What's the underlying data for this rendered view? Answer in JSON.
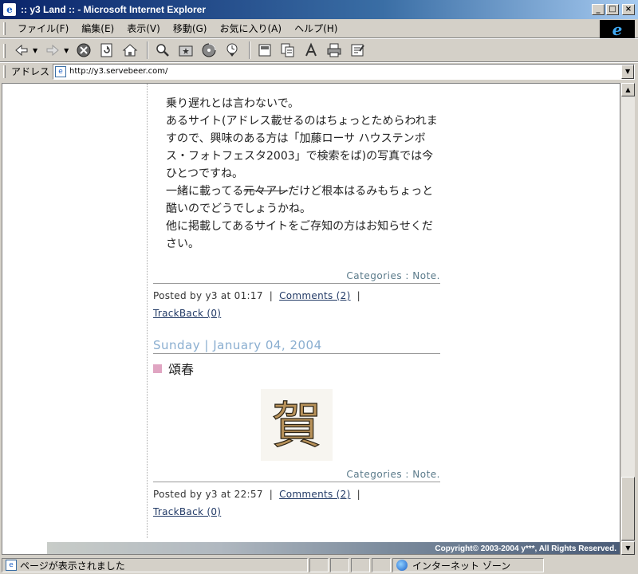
{
  "window": {
    "title": ":: y3 Land :: - Microsoft Internet Explorer",
    "minimize": "_",
    "maximize": "□",
    "close": "×"
  },
  "menu": {
    "items": [
      "ファイル(F)",
      "編集(E)",
      "表示(V)",
      "移動(G)",
      "お気に入り(A)",
      "ヘルプ(H)"
    ]
  },
  "address": {
    "label": "アドレス",
    "url": "http://y3.servebeer.com/"
  },
  "content": {
    "entry1": {
      "lines": [
        "乗り遅れとは言わないで。",
        "あるサイト(アドレス載せるのはちょっとためらわれますので、興味のある方は「加藤ローサ ハウステンボス・フォトフェスタ2003」で検索をば)の写真では今ひとつですね。"
      ],
      "line3_pre": "一緒に載ってる",
      "line3_strike": "元々アレ",
      "line3_post": "だけど根本はるみもちょっと酷いのでどうでしょうかね。",
      "line4": "他に掲載してあるサイトをご存知の方はお知らせください。",
      "categories": "Categories : Note.",
      "posted_by": "Posted by y3 at 01:17",
      "comments": "Comments (2)",
      "trackback": "TrackBack (0)"
    },
    "entry2": {
      "date": "Sunday | January 04, 2004",
      "title": "頌春",
      "image_char": "賀",
      "categories": "Categories : Note.",
      "posted_by": "Posted by y3 at 22:57",
      "comments": "Comments (2)",
      "trackback": "TrackBack (0)"
    },
    "copyright": "Copyright© 2003-2004 y***, All Rights Reserved."
  },
  "status": {
    "message": "ページが表示されました",
    "zone": "インターネット ゾーン"
  },
  "colors": {
    "title_start": "#0a246a",
    "title_end": "#a6caf0",
    "date_blue": "#8aaed0",
    "title_marker": "#e0a5c2",
    "link": "#223a66"
  }
}
